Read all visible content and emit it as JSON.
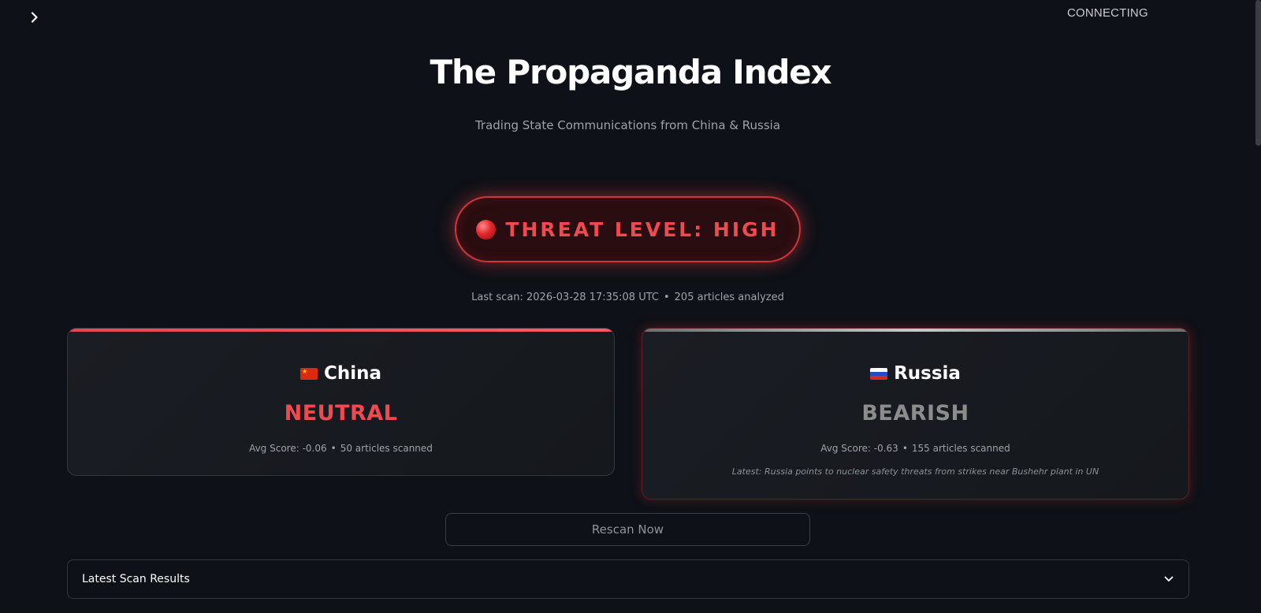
{
  "header": {
    "status": "CONNECTING"
  },
  "hero": {
    "title": "The Propaganda Index",
    "subtitle": "Trading State Communications from China & Russia"
  },
  "threat": {
    "text": "THREAT LEVEL: HIGH",
    "indicator_icon": "red-circle-icon",
    "color": "#ef4a4f"
  },
  "scan": {
    "last_scan": "Last scan: 2026-03-28 17:35:08 UTC",
    "separator": "•",
    "articles": "205 articles analyzed"
  },
  "countries": [
    {
      "name": "China",
      "flag_icon": "china-flag-icon",
      "sentiment": "NEUTRAL",
      "sentiment_color": "#ef4a4f",
      "accent_color": "#e5484d",
      "avg_score": "Avg Score: -0.06",
      "articles": "50 articles scanned"
    },
    {
      "name": "Russia",
      "flag_icon": "russia-flag-icon",
      "sentiment": "BEARISH",
      "sentiment_color": "#8c8c8c",
      "accent_color": "#9a9a9a",
      "avg_score": "Avg Score: -0.63",
      "articles": "155 articles scanned",
      "latest": "Latest: Russia points to nuclear safety threats from strikes near Bushehr plant in UN"
    }
  ],
  "actions": {
    "rescan_label": "Rescan Now"
  },
  "results": {
    "label": "Latest Scan Results",
    "toggle_icon": "chevron-down-icon"
  },
  "sidebar": {
    "toggle_icon": "chevron-right-icon"
  }
}
